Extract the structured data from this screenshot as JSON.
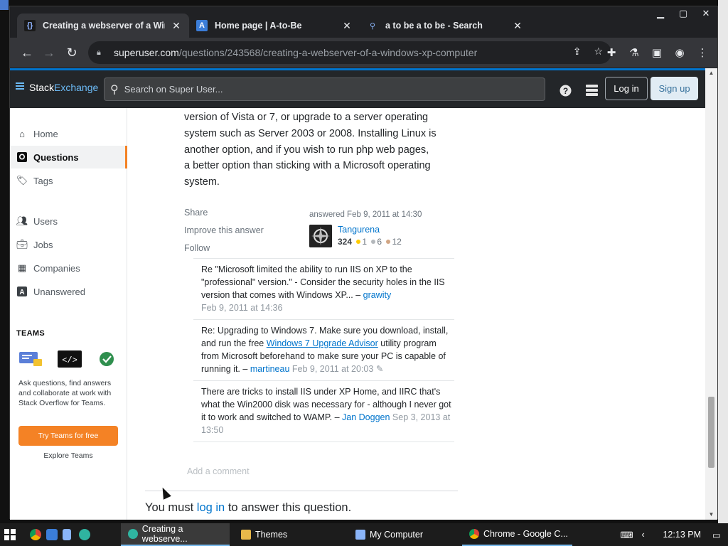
{
  "browser": {
    "tabs": [
      {
        "title": "Creating a webserver of a Windo",
        "icon": "superuser-icon"
      },
      {
        "title": "Home page | A-to-Be",
        "icon": "atobe-icon"
      },
      {
        "title": "a to be a to be - Search",
        "icon": "search-icon"
      }
    ],
    "url_host": "superuser.com",
    "url_path": "/questions/243568/creating-a-webserver-of-a-windows-xp-computer"
  },
  "site": {
    "logo_a": "Stack",
    "logo_b": "Exchange",
    "search_placeholder": "Search on Super User...",
    "login_label": "Log in",
    "signup_label": "Sign up"
  },
  "sidebar": {
    "items": [
      {
        "label": "Home",
        "icon": "home-icon"
      },
      {
        "label": "Questions",
        "icon": "questions-icon"
      },
      {
        "label": "Tags",
        "icon": "tag-icon"
      },
      {
        "label": "Users",
        "icon": "users-icon"
      },
      {
        "label": "Jobs",
        "icon": "briefcase-icon"
      },
      {
        "label": "Companies",
        "icon": "building-icon"
      },
      {
        "label": "Unanswered",
        "icon": "unanswered-icon"
      }
    ],
    "teams_heading": "TEAMS",
    "teams_text": "Ask questions, find answers and collaborate at work with Stack Overflow for Teams.",
    "teams_button": "Try Teams for free",
    "explore_link": "Explore Teams"
  },
  "answer": {
    "lines": [
      "version of Vista or 7, or upgrade to a server operating",
      "system such as Server 2003 or 2008. Installing Linux is",
      "another option, and if you wish to run php web pages,",
      "a better option than sticking with a Microsoft operating",
      "system."
    ],
    "share": "Share",
    "improve": "Improve this answer",
    "follow": "Follow",
    "answered": "answered Feb 9, 2011 at 14:30",
    "user": "Tangurena",
    "rep": "324",
    "gold": "1",
    "silver": "6",
    "bronze": "12"
  },
  "comments": [
    {
      "text": "Re \"Microsoft limited the ability to run IIS on XP to the \"professional\" version.\" - Consider the security holes in the IIS version that comes with Windows XP... –",
      "user": "grawity",
      "date": "Feb 9, 2011 at 14:36"
    },
    {
      "text_a": "Re: Upgrading to Windows 7. Make sure you download, install, and run the free",
      "link": "Windows 7 Upgrade Advisor",
      "text_b": "utility program from Microsoft beforehand to make sure your PC is capable of running it. –",
      "user": "martineau",
      "date": "Feb 9, 2011 at 20:03"
    },
    {
      "text": "There are tricks to install IIS under XP Home, and IIRC that's what the Win2000 disk was necessary for - although I never got it to work and switched to WAMP. –",
      "user": "Jan Doggen",
      "date": "Sep 3, 2013 at 13:50"
    }
  ],
  "add_comment": "Add a comment",
  "login_notice": {
    "a": "You must",
    "link": "log in",
    "b": "to answer this question."
  },
  "taskbar": {
    "tasks": [
      {
        "label": "Creating a webserve...",
        "icon": "edge-icon"
      },
      {
        "label": "Themes",
        "icon": "folder-icon"
      },
      {
        "label": "My Computer",
        "icon": "computer-icon"
      },
      {
        "label": "Chrome - Google C...",
        "icon": "chrome-icon"
      }
    ],
    "time": "12:13 PM"
  }
}
